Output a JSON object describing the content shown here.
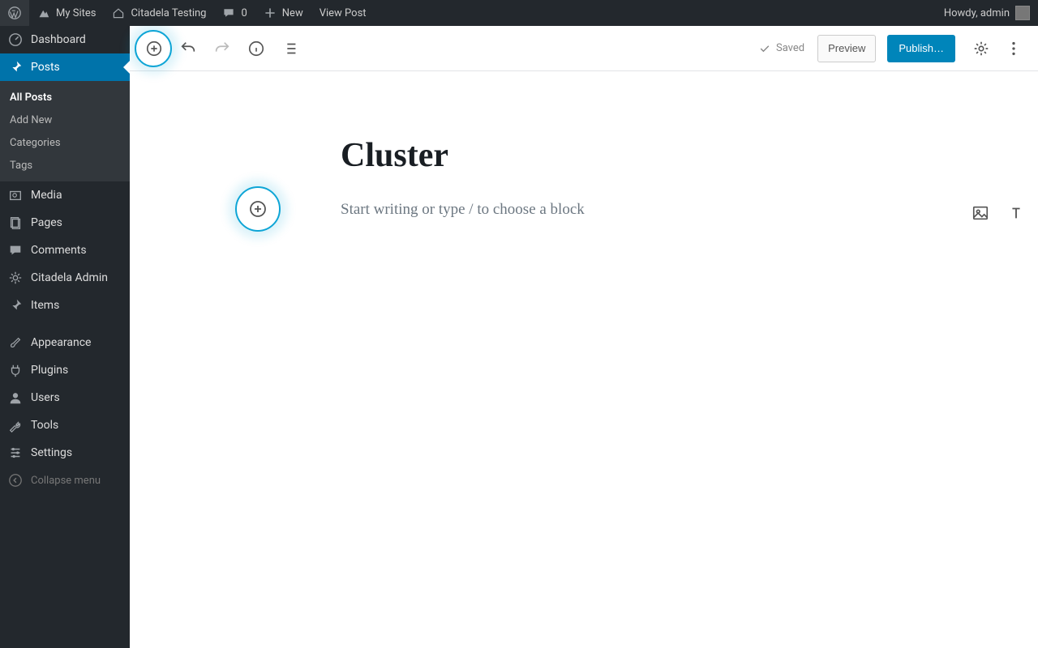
{
  "adminbar": {
    "my_sites": "My Sites",
    "site_name": "Citadela Testing",
    "comments_count": "0",
    "new_label": "New",
    "view_post": "View Post",
    "howdy": "Howdy, admin"
  },
  "sidebar": {
    "dashboard": "Dashboard",
    "posts": "Posts",
    "posts_submenu": {
      "all_posts": "All Posts",
      "add_new": "Add New",
      "categories": "Categories",
      "tags": "Tags"
    },
    "media": "Media",
    "pages": "Pages",
    "comments": "Comments",
    "citadela_admin": "Citadela Admin",
    "items": "Items",
    "appearance": "Appearance",
    "plugins": "Plugins",
    "users": "Users",
    "tools": "Tools",
    "settings": "Settings",
    "collapse": "Collapse menu"
  },
  "editor": {
    "saved": "Saved",
    "preview": "Preview",
    "publish": "Publish…",
    "post_title": "Cluster",
    "placeholder": "Start writing or type / to choose a block"
  },
  "icons": {
    "add_block": "plus-circle",
    "undo": "undo",
    "redo": "redo",
    "info": "info-circle",
    "outline": "list-outline",
    "settings": "gear",
    "more": "more-vertical",
    "image": "image",
    "heading": "heading-T",
    "gallery": "gallery"
  }
}
